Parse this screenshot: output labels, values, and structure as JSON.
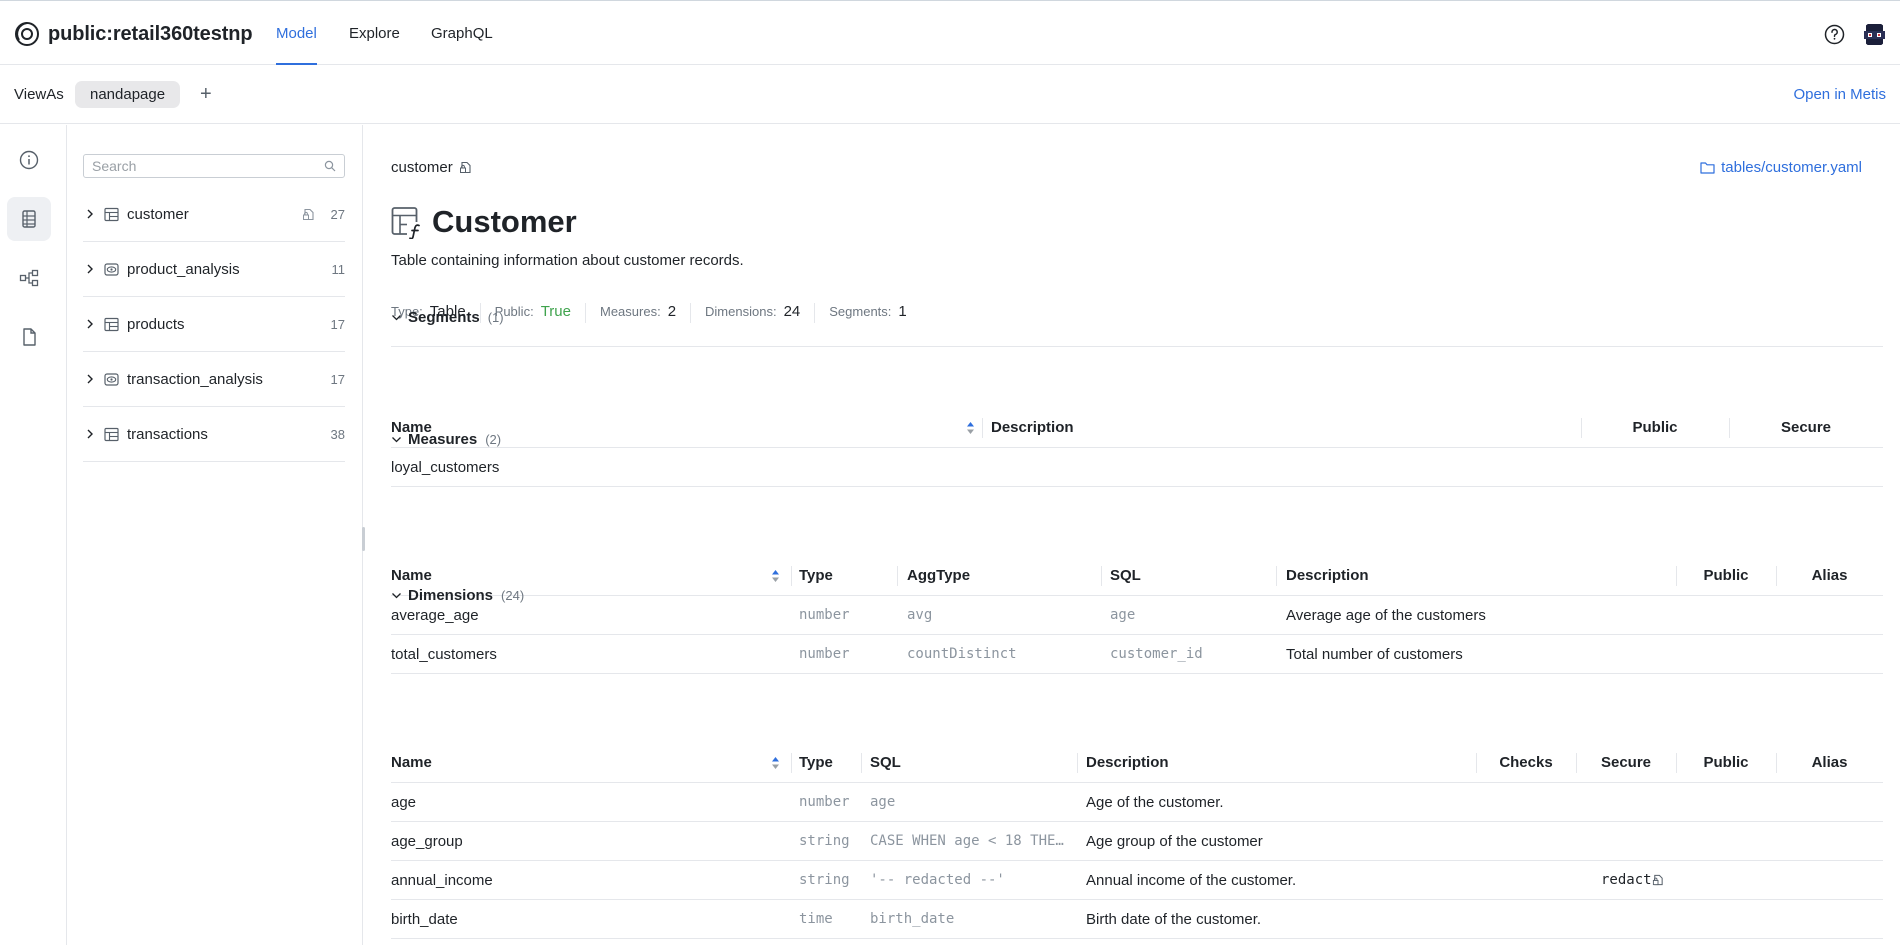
{
  "header": {
    "title": "public:retail360testnp",
    "tabs": [
      {
        "label": "Model",
        "active": true
      },
      {
        "label": "Explore",
        "active": false
      },
      {
        "label": "GraphQL",
        "active": false
      }
    ],
    "help_icon": "help-circle-icon",
    "accent": "#2f6fdd"
  },
  "viewas": {
    "label": "ViewAs",
    "chip": "nandapage",
    "add": "+",
    "open_link": "Open in Metis"
  },
  "rail": {
    "items": [
      {
        "icon": "info-icon",
        "active": false
      },
      {
        "icon": "table-list-icon",
        "active": true
      },
      {
        "icon": "graph-icon",
        "active": false
      },
      {
        "icon": "document-icon",
        "active": false
      }
    ]
  },
  "tree": {
    "search_placeholder": "Search",
    "items": [
      {
        "label": "customer",
        "count": "27",
        "icon": "table-icon",
        "locked": true
      },
      {
        "label": "product_analysis",
        "count": "11",
        "icon": "view-icon",
        "locked": false
      },
      {
        "label": "products",
        "count": "17",
        "icon": "table-icon",
        "locked": false
      },
      {
        "label": "transaction_analysis",
        "count": "17",
        "icon": "view-icon",
        "locked": false
      },
      {
        "label": "transactions",
        "count": "38",
        "icon": "table-icon",
        "locked": false
      }
    ]
  },
  "detail": {
    "breadcrumb": "customer",
    "file_link": "tables/customer.yaml",
    "title": "Customer",
    "description": "Table containing information about customer records.",
    "meta": [
      {
        "key": "Type:",
        "value": "Table"
      },
      {
        "key": "Public:",
        "value": "True"
      },
      {
        "key": "Measures:",
        "value": "2"
      },
      {
        "key": "Dimensions:",
        "value": "24"
      },
      {
        "key": "Segments:",
        "value": "1"
      }
    ],
    "public_color": "#3fa34d"
  },
  "segments": {
    "title": "Segments",
    "count": "(1)",
    "columns": [
      "Name",
      "Description",
      "Public",
      "Secure"
    ],
    "rows": [
      {
        "name": "loyal_customers",
        "description": "",
        "public": "",
        "secure": ""
      }
    ]
  },
  "measures": {
    "title": "Measures",
    "count": "(2)",
    "columns": [
      "Name",
      "Type",
      "AggType",
      "SQL",
      "Description",
      "Public",
      "Alias"
    ],
    "rows": [
      {
        "name": "average_age",
        "type": "number",
        "agg": "avg",
        "sql": "age",
        "description": "Average age of the customers",
        "public": "",
        "alias": ""
      },
      {
        "name": "total_customers",
        "type": "number",
        "agg": "countDistinct",
        "sql": "customer_id",
        "description": "Total number of customers",
        "public": "",
        "alias": ""
      }
    ]
  },
  "dimensions": {
    "title": "Dimensions",
    "count": "(24)",
    "columns": [
      "Name",
      "Type",
      "SQL",
      "Description",
      "Checks",
      "Secure",
      "Public",
      "Alias"
    ],
    "rows": [
      {
        "name": "age",
        "type": "number",
        "sql": "age",
        "description": "Age of the customer.",
        "checks": "",
        "secure": "",
        "public": "",
        "alias": ""
      },
      {
        "name": "age_group",
        "type": "string",
        "sql": "CASE WHEN age < 18 THE…",
        "description": "Age group of the customer",
        "checks": "",
        "secure": "",
        "public": "",
        "alias": ""
      },
      {
        "name": "annual_income",
        "type": "string",
        "sql": "'-- redacted --'",
        "description": "Annual income of the customer.",
        "checks": "",
        "secure": "redact",
        "public": "",
        "alias": ""
      },
      {
        "name": "birth_date",
        "type": "time",
        "sql": "birth_date",
        "description": "Birth date of the customer.",
        "checks": "",
        "secure": "",
        "public": "",
        "alias": ""
      }
    ]
  }
}
